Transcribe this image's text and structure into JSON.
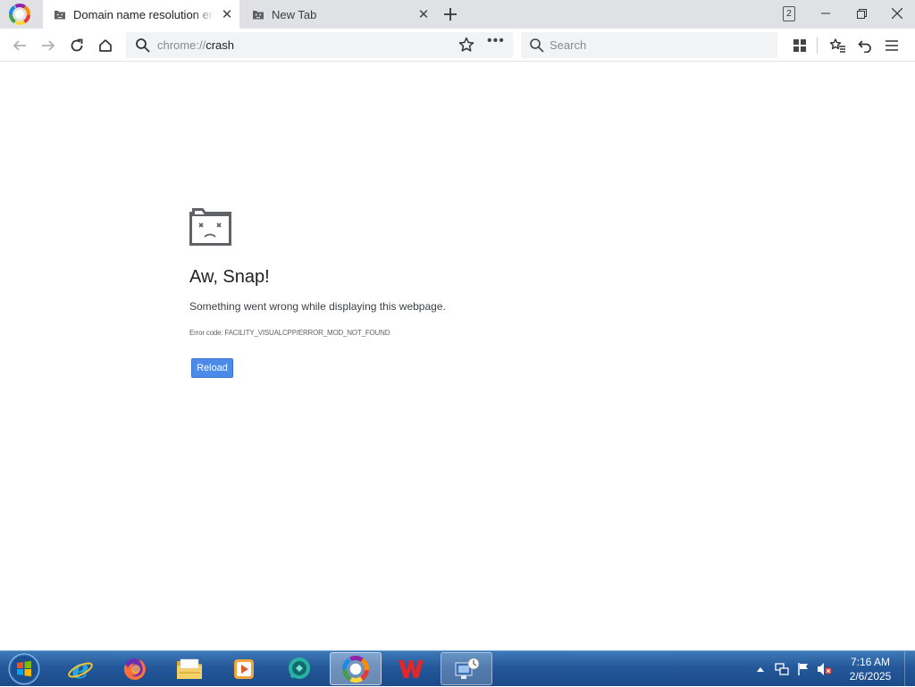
{
  "tabs": [
    {
      "title": "Domain name resolution error",
      "active": true
    },
    {
      "title": "New Tab",
      "active": false
    }
  ],
  "tab_count": "2",
  "toolbar": {
    "url_scheme": "chrome://",
    "url_path": "crash",
    "search_placeholder": "Search"
  },
  "error_page": {
    "title": "Aw, Snap!",
    "message": "Something went wrong while displaying this webpage.",
    "error_code": "Error code: FACILITY_VISUALCPP/ERROR_MOD_NOT_FOUND",
    "reload_label": "Reload"
  },
  "taskbar": {
    "apps": [
      "internet-explorer-icon",
      "firefox-icon",
      "file-explorer-icon",
      "media-player-icon",
      "chat-app-icon",
      "browser-icon",
      "wps-office-icon",
      "network-app-icon"
    ],
    "time": "7:16 AM",
    "date": "2/6/2025"
  },
  "colors": {
    "tab_bar": "#dfe1e5",
    "reload_button": "#4d8ae9",
    "taskbar": "#24589a"
  }
}
